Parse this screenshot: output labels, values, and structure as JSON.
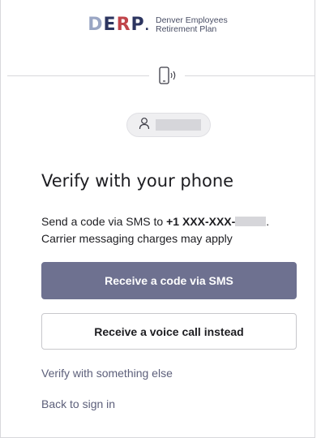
{
  "header": {
    "logo_mark": [
      "D",
      "E",
      "R",
      "P"
    ],
    "logo_line1": "Denver Employees",
    "logo_line2": "Retirement Plan"
  },
  "icons": {
    "divider_icon": "phone-icon",
    "user_icon": "user-icon"
  },
  "user": {
    "identifier_masked": true
  },
  "main": {
    "title": "Verify with your phone",
    "desc_prefix": "Send a code via SMS to ",
    "desc_phone": "+1 XXX-XXX-",
    "desc_suffix": ".",
    "desc_line2": "Carrier messaging charges may apply",
    "sms_button": "Receive a code via SMS",
    "voice_button": "Receive a voice call instead",
    "verify_else_link": "Verify with something else",
    "back_link": "Back to sign in"
  },
  "colors": {
    "primary_button": "#6e7190",
    "link": "#5c5f7a",
    "logo_red": "#c0444a",
    "logo_navy": "#2c3560"
  }
}
